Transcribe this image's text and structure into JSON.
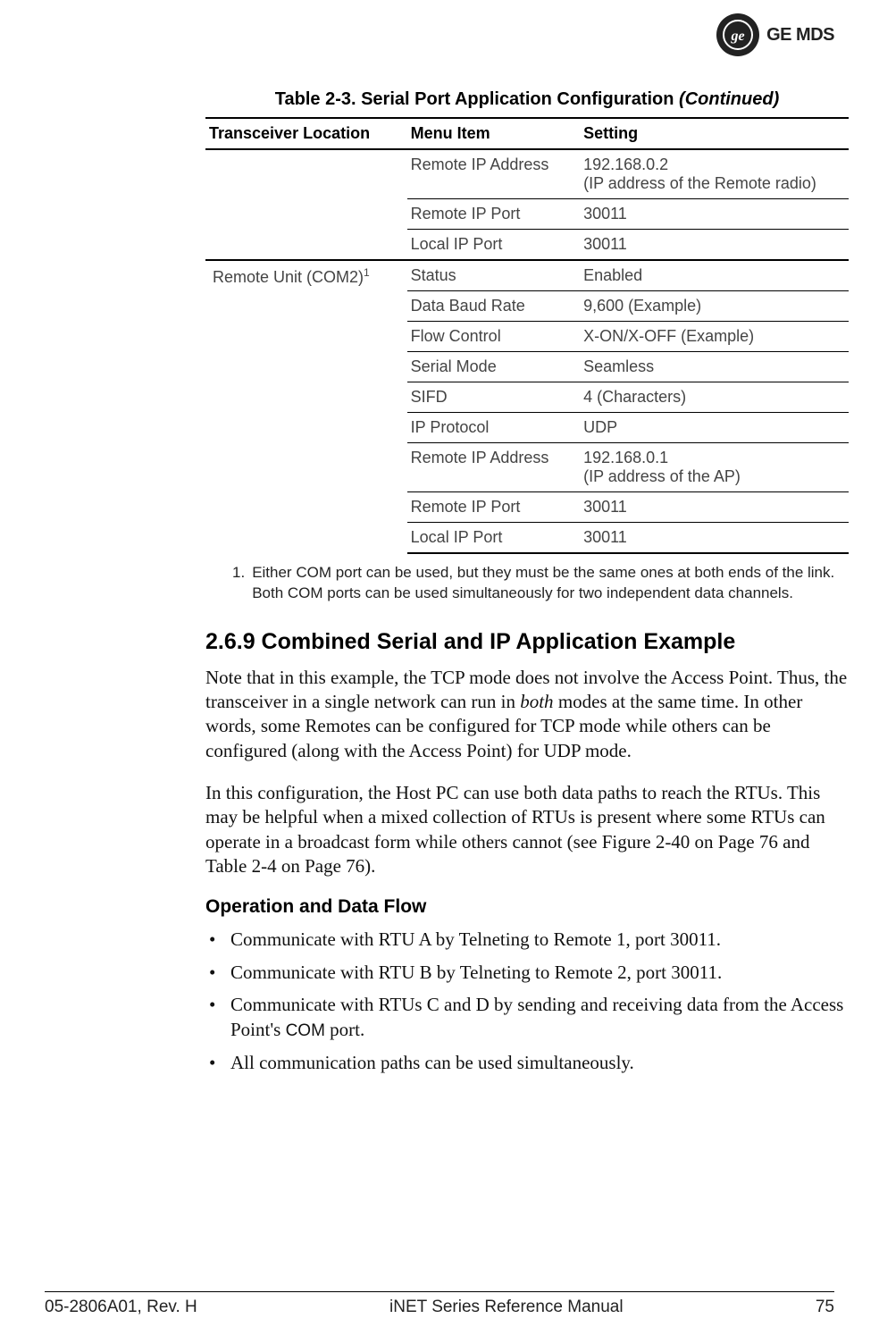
{
  "logo": {
    "monogram_alt": "GE",
    "brand": "GE MDS"
  },
  "table": {
    "caption_main": "Table 2-3. Serial Port Application Configuration",
    "caption_suffix": " (Continued)",
    "headers": {
      "col1": "Transceiver Location",
      "col2": "Menu Item",
      "col3": "Setting"
    },
    "group1": {
      "location": "",
      "rows": [
        {
          "menu": "Remote IP Address",
          "setting": "192.168.0.2\n(IP address of the Remote radio)"
        },
        {
          "menu": "Remote IP Port",
          "setting": "30011"
        },
        {
          "menu": "Local IP Port",
          "setting": "30011"
        }
      ]
    },
    "group2": {
      "location_pre": "Remote Unit (COM2)",
      "location_sup": "1",
      "rows": [
        {
          "menu": "Status",
          "setting": "Enabled"
        },
        {
          "menu": "Data Baud Rate",
          "setting": "9,600 (Example)"
        },
        {
          "menu": "Flow Control",
          "setting": "X-ON/X-OFF (Example)"
        },
        {
          "menu": "Serial Mode",
          "setting": "Seamless"
        },
        {
          "menu": "SIFD",
          "setting": "4 (Characters)"
        },
        {
          "menu": "IP Protocol",
          "setting": "UDP"
        },
        {
          "menu": "Remote IP Address",
          "setting": "192.168.0.1\n(IP address of the AP)"
        },
        {
          "menu": "Remote IP Port",
          "setting": "30011"
        },
        {
          "menu": "Local IP Port",
          "setting": "30011"
        }
      ]
    }
  },
  "footnote": {
    "num": "1.",
    "text": "Either COM port can be used, but they must be the same ones at both ends of the link. Both COM ports can be used simultaneously for two independent data channels."
  },
  "section": {
    "heading": "2.6.9 Combined Serial and IP Application Example",
    "para1_a": "Note that in this example, the TCP mode does not involve the Access Point. Thus, the transceiver in a single network can run in ",
    "para1_em": "both",
    "para1_b": " modes at the same time. In other words, some Remotes can be configured for TCP mode while others can be configured (along with the Access Point) for UDP mode.",
    "para2": "In this configuration, the Host PC can use both data paths to reach the RTUs. This may be helpful when a mixed collection of RTUs is present where some RTUs can operate in a broadcast form while others cannot (see Figure 2-40 on Page 76 and Table 2-4 on Page 76).",
    "subheading": "Operation and Data Flow",
    "bullets": [
      "Communicate with RTU A by Telneting to Remote 1, port 30011.",
      "Communicate with RTU B by Telneting to Remote 2, port 30011.",
      "Communicate with RTUs C and D by sending and receiving data from the Access Point's COM port.",
      "All communication paths can be used simultaneously."
    ]
  },
  "footer": {
    "left": "05-2806A01, Rev. H",
    "center": "iNET Series Reference Manual",
    "right": "75"
  }
}
